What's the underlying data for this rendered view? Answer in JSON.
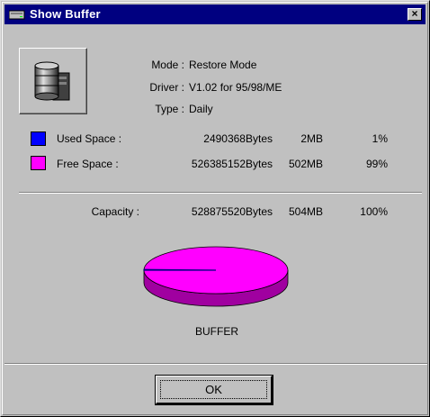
{
  "window": {
    "title": "Show Buffer",
    "close_label": "×"
  },
  "info": {
    "mode_label": "Mode :",
    "mode_value": "Restore Mode",
    "driver_label": "Driver :",
    "driver_value": "V1.02 for 95/98/ME",
    "type_label": "Type :",
    "type_value": "Daily"
  },
  "used": {
    "label": "Used Space :",
    "bytes": "2490368Bytes",
    "mb": "2MB",
    "percent": "1%",
    "color": "#0000ff"
  },
  "free": {
    "label": "Free Space :",
    "bytes": "526385152Bytes",
    "mb": "502MB",
    "percent": "99%",
    "color": "#ff00ff"
  },
  "capacity": {
    "label": "Capacity :",
    "bytes": "528875520Bytes",
    "mb": "504MB",
    "percent": "100%"
  },
  "chart": {
    "label": "BUFFER",
    "used_fraction": 0.0047,
    "used_color": "#0000ff",
    "free_color": "#ff00ff",
    "free_side_color": "#a000a0"
  },
  "buttons": {
    "ok_label": "OK"
  }
}
